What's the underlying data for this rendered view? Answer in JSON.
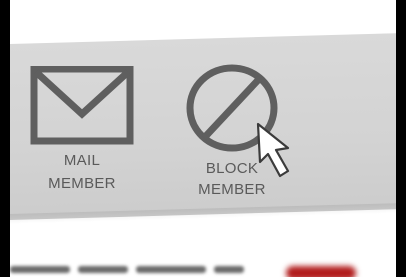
{
  "actions": {
    "mail": {
      "line1": "MAIL",
      "line2": "MEMBER",
      "icon": "envelope-icon"
    },
    "block": {
      "line1": "BLOCK",
      "line2": "MEMBER",
      "icon": "block-icon"
    }
  },
  "colors": {
    "panel": "#d3d3d3",
    "icon": "#5a5a5a",
    "background": "#000000",
    "accent": "#b21d1d"
  },
  "cursor": {
    "icon": "pointer-arrow-icon"
  }
}
